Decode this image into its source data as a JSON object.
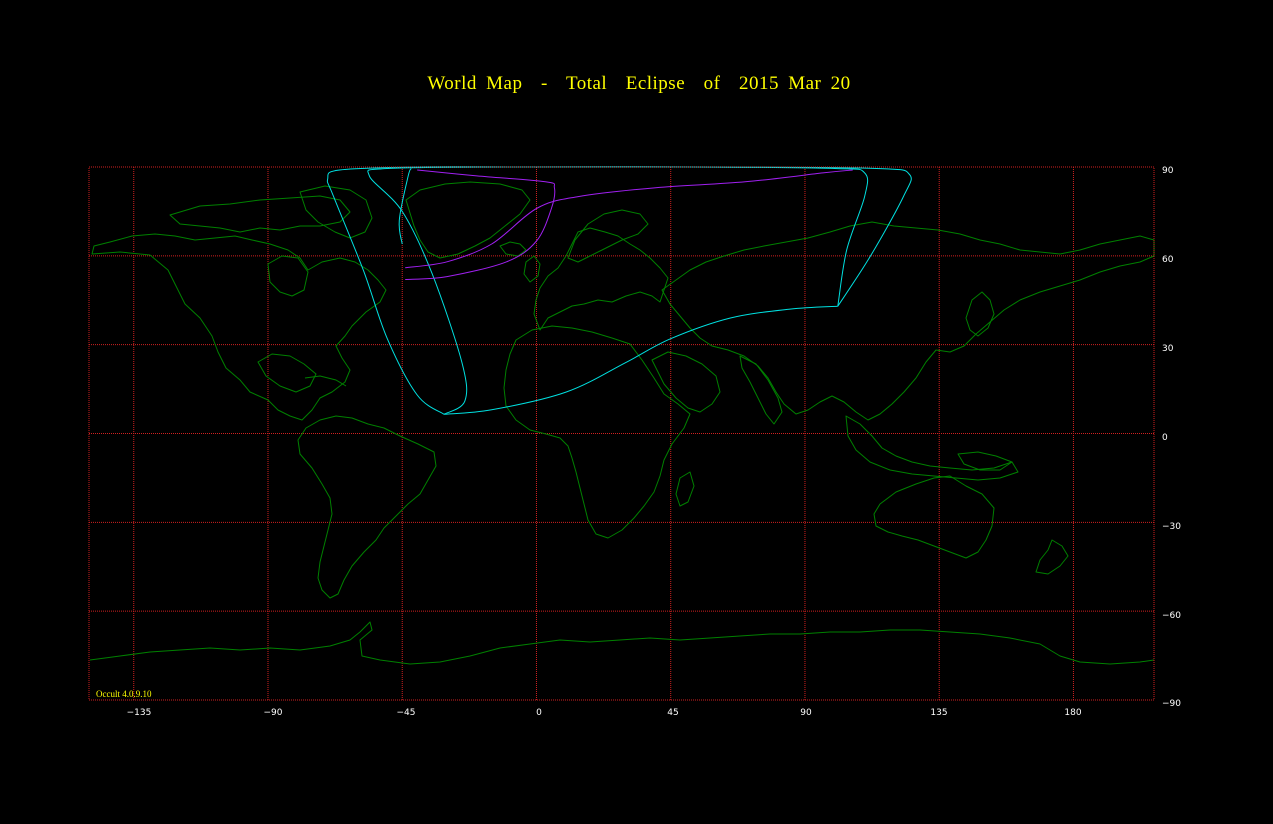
{
  "title": "World Map  -  Total  Eclipse  of  2015 Mar 20",
  "version": "Occult 4.0.9.10",
  "colors": {
    "background": "#000000",
    "title": "#ffff00",
    "grid": "#d02020",
    "coastline": "#008000",
    "eclipse_limits": "#00e0e0",
    "central_path": "#a020f0",
    "tick_labels": "#ffffff",
    "version": "#ffff00"
  },
  "axes": {
    "x_ticks": [
      "−135",
      "−90",
      "−45",
      "0",
      "45",
      "90",
      "135",
      "180"
    ],
    "y_ticks": [
      "90",
      "60",
      "30",
      "0",
      "−30",
      "−60",
      "−90"
    ]
  },
  "map_data": {
    "projection": "equirectangular",
    "lon_range": [
      -150,
      207
    ],
    "lat_range": [
      -90,
      90
    ],
    "grid_lons": [
      -135,
      -90,
      -45,
      0,
      45,
      90,
      135,
      180
    ],
    "grid_lats": [
      60,
      30,
      0,
      -30,
      -60
    ],
    "eclipse_limit_curves": [
      [
        [
          -31,
          6.5
        ],
        [
          -15,
          8
        ],
        [
          10,
          14
        ],
        [
          30,
          24
        ],
        [
          45,
          32
        ],
        [
          65,
          39
        ],
        [
          85,
          42
        ],
        [
          101,
          43
        ]
      ],
      [
        [
          -31,
          6.5
        ],
        [
          -40,
          13
        ],
        [
          -50,
          32
        ],
        [
          -58,
          55
        ],
        [
          -68,
          80
        ],
        [
          -70,
          86
        ],
        [
          -66,
          89
        ],
        [
          -40,
          90
        ],
        [
          0,
          90
        ],
        [
          60,
          90
        ],
        [
          114,
          89.5
        ],
        [
          125,
          87.5
        ],
        [
          123,
          80
        ],
        [
          112,
          60
        ],
        [
          101,
          43
        ]
      ],
      [
        [
          -31,
          6.5
        ],
        [
          -24,
          11
        ],
        [
          -25,
          24
        ],
        [
          -35,
          54
        ],
        [
          -45,
          75
        ],
        [
          -56,
          87
        ],
        [
          -50,
          89.5
        ],
        [
          -10,
          90
        ],
        [
          50,
          90
        ],
        [
          100,
          89.5
        ],
        [
          110,
          88
        ],
        [
          110,
          80
        ],
        [
          104,
          62
        ],
        [
          101,
          43
        ]
      ],
      [
        [
          -42,
          89.5
        ],
        [
          -43,
          87
        ],
        [
          -46,
          72
        ],
        [
          -45,
          64
        ]
      ]
    ],
    "central_path": [
      [
        [
          -44,
          56
        ],
        [
          -30,
          58
        ],
        [
          -15,
          64
        ],
        [
          0,
          76
        ],
        [
          14,
          80
        ],
        [
          40,
          83
        ],
        [
          70,
          85
        ],
        [
          96,
          88
        ],
        [
          106,
          89
        ]
      ],
      [
        [
          -44,
          52
        ],
        [
          -30,
          53
        ],
        [
          -10,
          58
        ],
        [
          0,
          65
        ],
        [
          5,
          76
        ],
        [
          6,
          83
        ],
        [
          3,
          85
        ],
        [
          -20,
          87
        ],
        [
          -40,
          89
        ]
      ]
    ]
  }
}
